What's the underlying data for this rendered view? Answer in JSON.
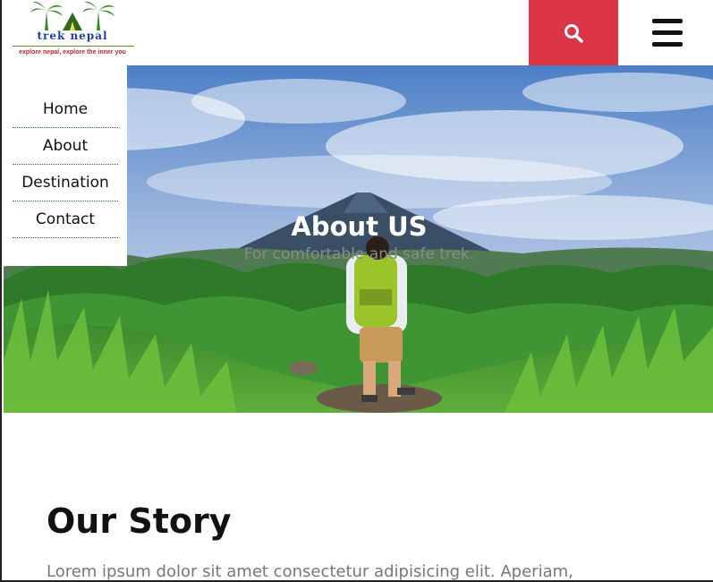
{
  "brand": {
    "name": "trek nepal",
    "tagline": "explore nepal, explore the inner you",
    "accent": "#dc3545"
  },
  "header": {
    "search_icon": "search-icon",
    "menu_icon": "hamburger-menu-icon"
  },
  "nav": {
    "items": [
      {
        "label": "Home"
      },
      {
        "label": "About"
      },
      {
        "label": "Destination"
      },
      {
        "label": "Contact"
      }
    ]
  },
  "hero": {
    "title": "About US",
    "subtitle": "For comfortable and safe trek."
  },
  "story": {
    "title": "Our Story",
    "text": "Lorem ipsum dolor sit amet consectetur adipisicing elit. Aperiam,"
  }
}
